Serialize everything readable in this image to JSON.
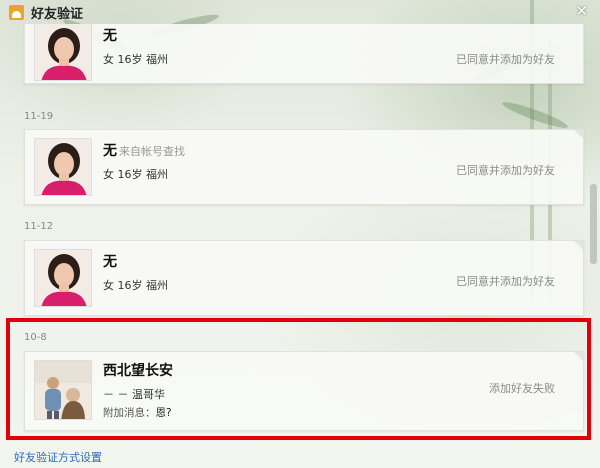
{
  "window": {
    "title": "好友验证",
    "close_glyph": "✕"
  },
  "requests": [
    {
      "date": "",
      "name": "无",
      "source": "",
      "info": "女 16岁 福州",
      "status": "已同意并添加为好友",
      "extra_label": "",
      "extra_value": ""
    },
    {
      "date": "11-19",
      "name": "无",
      "source": "来自帐号查找",
      "info": "女 16岁 福州",
      "status": "已同意并添加为好友",
      "extra_label": "",
      "extra_value": ""
    },
    {
      "date": "11-12",
      "name": "无",
      "source": "",
      "info": "女 16岁 福州",
      "status": "已同意并添加为好友",
      "extra_label": "",
      "extra_value": ""
    },
    {
      "date": "10-8",
      "name": "西北望长安",
      "source": "",
      "info": "－ － 温哥华",
      "status": "添加好友失败",
      "extra_label": "附加消息：",
      "extra_value": "恩?"
    }
  ],
  "footer": {
    "settings_link": "好友验证方式设置"
  },
  "colors": {
    "highlight": "#e0000a",
    "link": "#2a6db5",
    "title_icon": "#e9a52b"
  },
  "icons": {
    "title": "qq-user-icon",
    "close": "close-icon"
  }
}
